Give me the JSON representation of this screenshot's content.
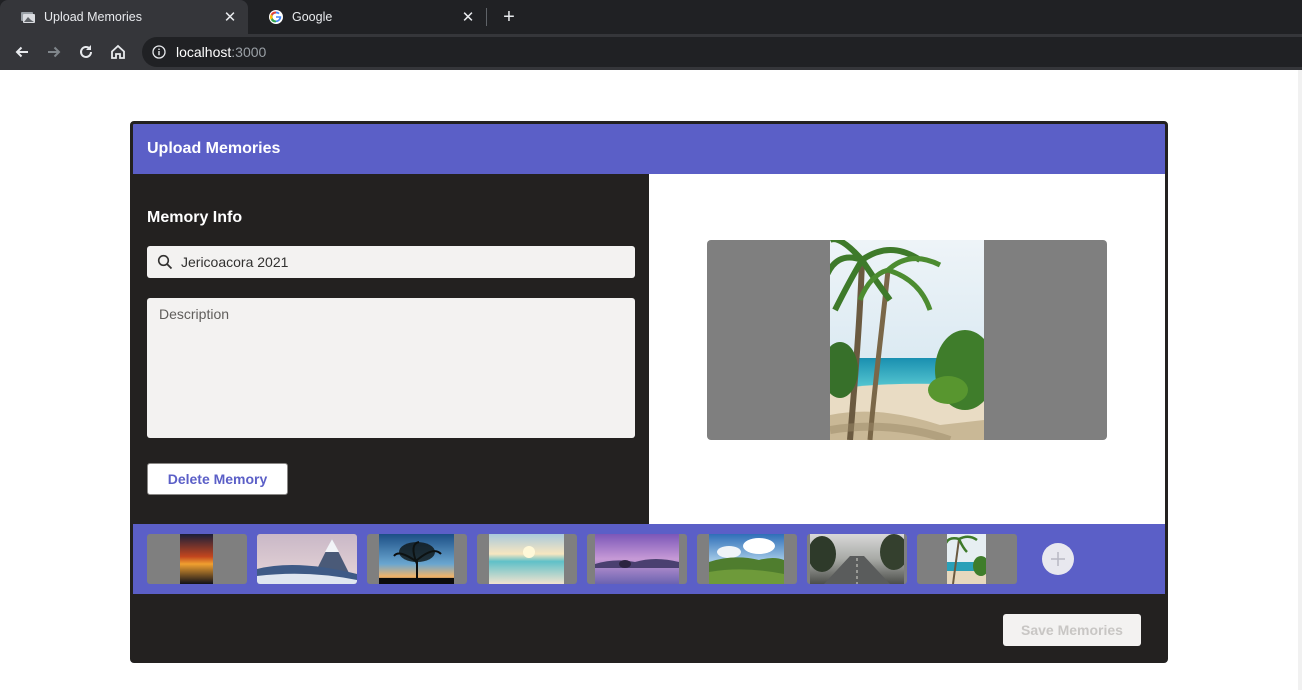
{
  "browser": {
    "tabs": [
      {
        "title": "Upload Memories",
        "active": true,
        "icon": "photos-favicon-icon"
      },
      {
        "title": "Google",
        "active": false,
        "icon": "google-favicon-icon"
      }
    ],
    "close_glyph": "✕",
    "new_tab_glyph": "+",
    "address": {
      "host": "localhost",
      "port": ":3000"
    }
  },
  "app": {
    "header_title": "Upload Memories",
    "memory_info": {
      "section_title": "Memory Info",
      "title_value": "Jericoacora 2021",
      "description_placeholder": "Description",
      "delete_label": "Delete Memory"
    },
    "preview": {
      "subject": "palm trees on a tropical beach"
    },
    "thumbnails": [
      {
        "subject": "sunset vertical",
        "selected": false
      },
      {
        "subject": "snowy mountain",
        "selected": false
      },
      {
        "subject": "tree at dusk",
        "selected": false
      },
      {
        "subject": "beach sunrise",
        "selected": false
      },
      {
        "subject": "purple lake",
        "selected": false
      },
      {
        "subject": "green valley",
        "selected": false
      },
      {
        "subject": "foggy road",
        "selected": false
      },
      {
        "subject": "palm beach",
        "selected": true
      }
    ],
    "add_icon": "plus-icon",
    "save_label": "Save Memories",
    "save_disabled": true,
    "colors": {
      "accent": "#5b5fc7",
      "panel": "#232120",
      "preview_bg": "#7f7f7f"
    }
  }
}
